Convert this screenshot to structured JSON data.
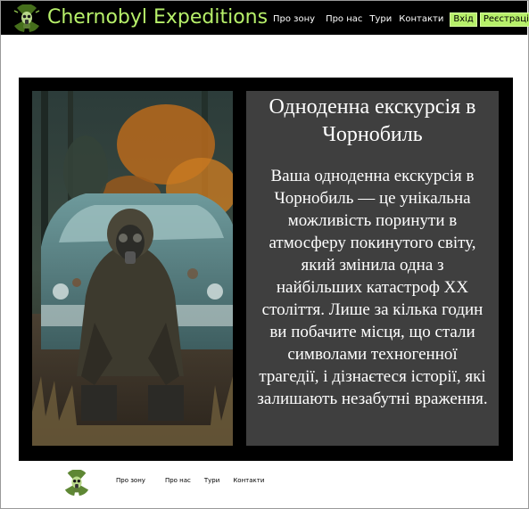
{
  "header": {
    "brand": "Chernobyl Expeditions",
    "logo_icon": "radiation-gasmask-logo-icon",
    "nav": {
      "about_zone": "Про зону",
      "about_us": "Про нас",
      "tours": "Тури",
      "contacts": "Контакти"
    },
    "login_label": "Вхід",
    "register_label": "Реєстрація"
  },
  "hero": {
    "image_icon": "stalker-gasmask-car-photo",
    "title": "Одноденна екскурсія в Чорнобиль",
    "body": "Ваша одноденна екскурсія в Чорнобиль — це унікальна можливість поринути в атмосферу покинутого світу, який змінила одна з найбільших катастроф ХХ століття. Лише за кілька годин ви побачите місця, що стали символами техногенної трагедії, і дізнаєтеся історії, які залишають незабутні враження."
  },
  "footer": {
    "logo_icon": "radiation-gasmask-logo-icon",
    "nav": {
      "about_zone": "Про зону",
      "about_us": "Про нас",
      "tours": "Тури",
      "contacts": "Контакти"
    }
  },
  "colors": {
    "accent": "#b7f06a",
    "header_bg": "#000000",
    "text_panel_bg": "#3f3f3f"
  }
}
